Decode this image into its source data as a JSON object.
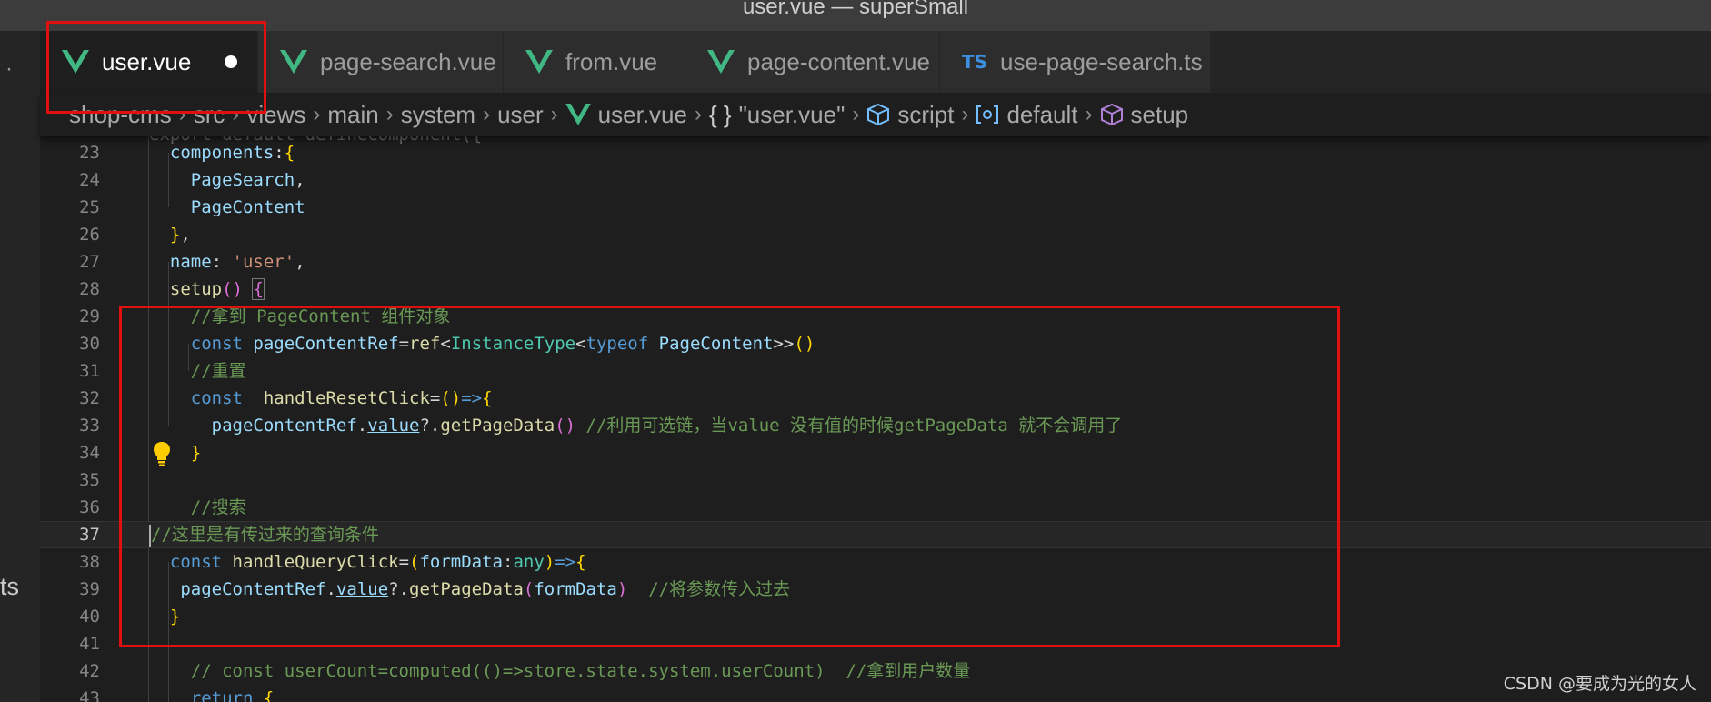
{
  "window": {
    "title": "user.vue — superSmall"
  },
  "activity_bar": {
    "overflow_dot": "·",
    "fragment": "ts"
  },
  "tabs": [
    {
      "label": "user.vue",
      "icon": "vue-icon",
      "active": true,
      "dirty": true
    },
    {
      "label": "page-search.vue",
      "icon": "vue-icon"
    },
    {
      "label": "from.vue",
      "icon": "vue-icon"
    },
    {
      "label": "page-content.vue",
      "icon": "vue-icon"
    },
    {
      "label": "use-page-search.ts",
      "icon": "ts-icon",
      "icon_text": "TS"
    }
  ],
  "breadcrumb": [
    {
      "label": "shop-cms"
    },
    {
      "label": "src"
    },
    {
      "label": "views"
    },
    {
      "label": "main"
    },
    {
      "label": "system"
    },
    {
      "label": "user"
    },
    {
      "label": "user.vue",
      "icon": "vue-icon"
    },
    {
      "label": "\"user.vue\"",
      "icon": "braces-icon",
      "icon_text": "{ }"
    },
    {
      "label": "script",
      "icon": "cube-icon"
    },
    {
      "label": "default",
      "icon": "module-icon"
    },
    {
      "label": "setup",
      "icon": "method-icon"
    }
  ],
  "editor": {
    "partial_top_line": "export default defineComponent({",
    "current_line": "37",
    "lines": [
      {
        "n": "23",
        "t": "  components:{"
      },
      {
        "n": "24",
        "t": "    PageSearch,"
      },
      {
        "n": "25",
        "t": "    PageContent"
      },
      {
        "n": "26",
        "t": "  },"
      },
      {
        "n": "27",
        "t": "  name: 'user',"
      },
      {
        "n": "28",
        "t": "  setup() {"
      },
      {
        "n": "29",
        "t": "    //拿到 PageContent 组件对象"
      },
      {
        "n": "30",
        "t": "    const pageContentRef=ref<InstanceType<typeof PageContent>>()"
      },
      {
        "n": "31",
        "t": "    //重置"
      },
      {
        "n": "32",
        "t": "    const  handleResetClick=()=>{"
      },
      {
        "n": "33",
        "t": "      pageContentRef.value?.getPageData() //利用可选链，当value 没有值的时候getPageData 就不会调用了"
      },
      {
        "n": "34",
        "t": "    }"
      },
      {
        "n": "35",
        "t": ""
      },
      {
        "n": "36",
        "t": "    //搜索"
      },
      {
        "n": "37",
        "t": "//这里是有传过来的查询条件"
      },
      {
        "n": "38",
        "t": "  const handleQueryClick=(formData:any)=>{"
      },
      {
        "n": "39",
        "t": "   pageContentRef.value?.getPageData(formData)  //将参数传入过去"
      },
      {
        "n": "40",
        "t": "  }"
      },
      {
        "n": "41",
        "t": ""
      },
      {
        "n": "42",
        "t": "    // const userCount=computed(()=>store.state.system.userCount)  //拿到用户数量"
      },
      {
        "n": "43",
        "t": "    return {"
      }
    ]
  },
  "watermark": "CSDN @要成为光的女人",
  "colors": {
    "annotation_red": "#e01010",
    "keyword": "#569cd6",
    "function": "#dcdcaa",
    "variable": "#9cdcfe",
    "type": "#4ec9b0",
    "string": "#ce9178",
    "comment": "#6a9955",
    "vue_green": "#41b883",
    "ts_blue": "#3d8ee0",
    "lightbulb": "#ffcc00"
  }
}
